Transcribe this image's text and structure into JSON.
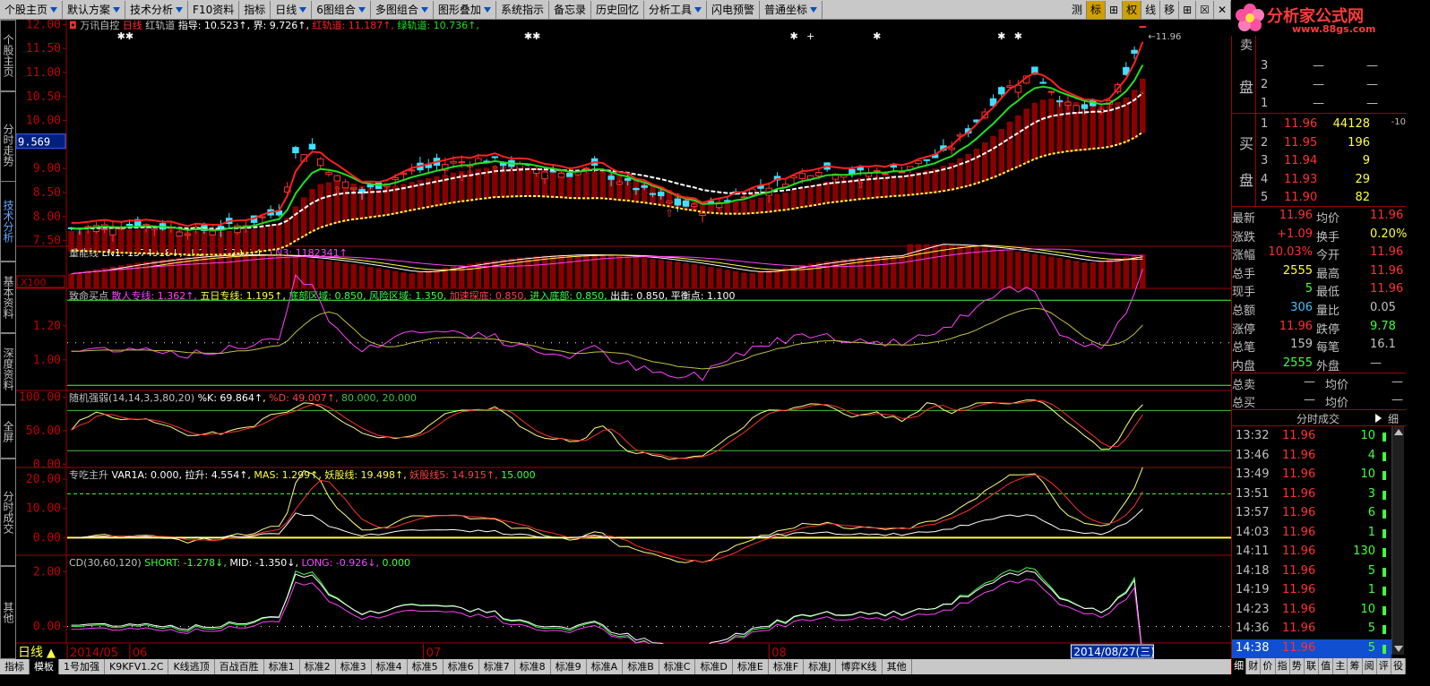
{
  "toolbar": {
    "items": [
      {
        "label": "个股主页",
        "arrow": true
      },
      {
        "label": "默认方案",
        "arrow": true
      },
      {
        "label": "技术分析",
        "arrow": true
      },
      {
        "label": "F10资料",
        "arrow": false
      },
      {
        "label": "指标",
        "arrow": false
      },
      {
        "label": "日线",
        "arrow": true
      },
      {
        "label": "6图组合",
        "arrow": true
      },
      {
        "label": "多图组合",
        "arrow": true
      },
      {
        "label": "图形叠加",
        "arrow": true
      },
      {
        "label": "系统指示",
        "arrow": false
      },
      {
        "label": "备忘录",
        "arrow": false
      },
      {
        "label": "历史回忆",
        "arrow": false
      },
      {
        "label": "分析工具",
        "arrow": true
      },
      {
        "label": "闪电预警",
        "arrow": false
      },
      {
        "label": "普通坐标",
        "arrow": true
      }
    ],
    "right_buttons": [
      "测",
      "标",
      "⊞",
      "权",
      "线",
      "移",
      "⊞",
      "☒",
      "✕"
    ]
  },
  "logo": {
    "title": "分析家公式网",
    "url": "www.88gs.com"
  },
  "left_nav": [
    "个股主页",
    "分时走势",
    "技术分析",
    "基本资料",
    "深度资料",
    "全屏",
    "分时成交",
    "其他"
  ],
  "left_nav_active": 2,
  "main_chart": {
    "header": {
      "name": "万讯自控",
      "period": "日线",
      "indicator": "红轨道",
      "items": [
        {
          "text": "指导: 10.523↑,",
          "color": "#ffffff"
        },
        {
          "text": "界: 9.726↑,",
          "color": "#ffffff"
        },
        {
          "text": "红轨道: 11.187↑,",
          "color": "#ff2020"
        },
        {
          "text": "绿轨道: 10.736↑,",
          "color": "#20e020"
        }
      ]
    },
    "y_ticks": [
      "12.00",
      "11.50",
      "11.00",
      "10.50",
      "10.00",
      "9.50",
      "9.00",
      "8.50",
      "8.00",
      "7.50"
    ],
    "y_range": [
      7.4,
      12.1
    ],
    "cursor_price": "9.569",
    "max_label": "11.96"
  },
  "volume": {
    "header": "量能线",
    "items": [
      {
        "text": "LN1: 1374918↓,",
        "color": "#ffffff"
      },
      {
        "text": "LN2: 1372911↑,",
        "color": "#ffff40"
      },
      {
        "text": "LN3: 1182341↑",
        "color": "#ff40ff"
      }
    ],
    "scale_label": "X100"
  },
  "p1": {
    "header": "致命买点",
    "items": [
      {
        "text": "散人专线: 1.362↑,",
        "color": "#ff40ff"
      },
      {
        "text": "五日专线: 1.195↑,",
        "color": "#ffff40"
      },
      {
        "text": "底部区域: 0.850,",
        "color": "#40ff40"
      },
      {
        "text": "风险区域: 1.350,",
        "color": "#40ff40"
      },
      {
        "text": "加速探底: 0.850,",
        "color": "#ff4040"
      },
      {
        "text": "进入底部: 0.850,",
        "color": "#40ff40"
      },
      {
        "text": "出击: 0.850,",
        "color": "#ffffff"
      },
      {
        "text": "平衡点: 1.100",
        "color": "#ffffff"
      }
    ],
    "y_ticks": [
      "1.20",
      "1.00"
    ]
  },
  "p2": {
    "header": "随机强弱(14,14,3,3,80,20)",
    "items": [
      {
        "text": "%K: 69.864↑,",
        "color": "#ffffff"
      },
      {
        "text": "%D: 49.007↑,",
        "color": "#ff4040"
      },
      {
        "text": "80.000,",
        "color": "#40c040"
      },
      {
        "text": "20.000",
        "color": "#40c040"
      }
    ],
    "y_ticks": [
      "100.00",
      "50.00",
      "0.00"
    ]
  },
  "p3": {
    "header": "专吃主升",
    "items": [
      {
        "text": "VAR1A: 0.000,",
        "color": "#ffffff"
      },
      {
        "text": "拉升: 4.554↑,",
        "color": "#ffffff"
      },
      {
        "text": "MAS: 1.299↑,",
        "color": "#ffff40"
      },
      {
        "text": "妖股线: 19.498↑,",
        "color": "#ffff40"
      },
      {
        "text": "妖股线5: 14.915↑,",
        "color": "#ff4040"
      },
      {
        "text": "15.000",
        "color": "#40ff40"
      }
    ],
    "y_ticks": [
      "20.00",
      "10.00",
      "0.00"
    ]
  },
  "p4": {
    "header": "CD(30,60,120)",
    "items": [
      {
        "text": "SHORT: -1.278↓,",
        "color": "#40ff40"
      },
      {
        "text": "MID: -1.350↓,",
        "color": "#ffffff"
      },
      {
        "text": "LONG: -0.926↓,",
        "color": "#ff40ff"
      },
      {
        "text": "0.000",
        "color": "#40ff40"
      }
    ],
    "y_ticks": [
      "2.00",
      "0.00"
    ]
  },
  "time_axis": {
    "period_label": "日线",
    "labels": [
      {
        "text": "2014/05",
        "at": 0.0
      },
      {
        "text": "06",
        "at": 0.058
      },
      {
        "text": "07",
        "at": 0.33
      },
      {
        "text": "08",
        "at": 0.65
      }
    ],
    "cursor_date": "2014/08/27(三)"
  },
  "bottom_tabs": {
    "tabs": [
      "指标",
      "模板",
      "1号加强",
      "K9KFV1.2C",
      "K线逃顶",
      "百战百胜",
      "标准1",
      "标准2",
      "标准3",
      "标准4",
      "标准5",
      "标准6",
      "标准7",
      "标准8",
      "标准9",
      "标准A",
      "标准B",
      "标准C",
      "标准D",
      "标准E",
      "标准F",
      "标准J",
      "博弈K线",
      "其他"
    ],
    "active": 1
  },
  "order_book": {
    "sell": [
      {
        "level": "3",
        "price": "—",
        "volume": "—"
      },
      {
        "level": "2",
        "price": "—",
        "volume": "—"
      },
      {
        "level": "1",
        "price": "—",
        "volume": "—"
      }
    ],
    "sell_label": "卖盘",
    "buy_label": "买盘",
    "buy": [
      {
        "level": "1",
        "price": "11.96",
        "volume": "44128",
        "extra": "-10"
      },
      {
        "level": "2",
        "price": "11.95",
        "volume": "196",
        "extra": ""
      },
      {
        "level": "3",
        "price": "11.94",
        "volume": "9",
        "extra": ""
      },
      {
        "level": "4",
        "price": "11.93",
        "volume": "29",
        "extra": ""
      },
      {
        "level": "5",
        "price": "11.90",
        "volume": "82",
        "extra": ""
      }
    ]
  },
  "quote": {
    "rows": [
      {
        "l1": "最新",
        "v1": "11.96",
        "c1": "#ff3030",
        "l2": "均价",
        "v2": "11.96",
        "c2": "#ff3030"
      },
      {
        "l1": "涨跌",
        "v1": "+1.09",
        "c1": "#ff3030",
        "l2": "换手",
        "v2": "0.20%",
        "c2": "#ffff40"
      },
      {
        "l1": "涨幅",
        "v1": "10.03%",
        "c1": "#ff3030",
        "l2": "今开",
        "v2": "11.96",
        "c2": "#ff3030"
      },
      {
        "l1": "总手",
        "v1": "2555",
        "c1": "#ffff40",
        "l2": "最高",
        "v2": "11.96",
        "c2": "#ff3030"
      },
      {
        "l1": "现手",
        "v1": "5",
        "c1": "#40ff40",
        "l2": "最低",
        "v2": "11.96",
        "c2": "#ff3030"
      },
      {
        "l1": "总额",
        "v1": "306",
        "c1": "#40c0ff",
        "l2": "量比",
        "v2": "0.05",
        "c2": "#c0c0c0"
      },
      {
        "l1": "涨停",
        "v1": "11.96",
        "c1": "#ff3030",
        "l2": "跌停",
        "v2": "9.78",
        "c2": "#40ff40"
      },
      {
        "l1": "总笔",
        "v1": "159",
        "c1": "#c0c0c0",
        "l2": "每笔",
        "v2": "16.1",
        "c2": "#c0c0c0"
      },
      {
        "l1": "内盘",
        "v1": "2555",
        "c1": "#40ff40",
        "l2": "外盘",
        "v2": "—",
        "c2": "#c0c0c0"
      }
    ],
    "extra": [
      {
        "l1": "总卖",
        "v1": "—",
        "l2": "均价",
        "v2": "—"
      },
      {
        "l1": "总买",
        "v1": "—",
        "l2": "均价",
        "v2": "—"
      }
    ]
  },
  "ticks": {
    "header": "分时成交",
    "group": "细",
    "rows": [
      {
        "time": "13:32",
        "price": "11.96",
        "vol": "10"
      },
      {
        "time": "13:46",
        "price": "11.96",
        "vol": "4"
      },
      {
        "time": "13:49",
        "price": "11.96",
        "vol": "10"
      },
      {
        "time": "13:51",
        "price": "11.96",
        "vol": "3"
      },
      {
        "time": "13:57",
        "price": "11.96",
        "vol": "6"
      },
      {
        "time": "14:03",
        "price": "11.96",
        "vol": "1"
      },
      {
        "time": "14:11",
        "price": "11.96",
        "vol": "130"
      },
      {
        "time": "14:18",
        "price": "11.96",
        "vol": "5"
      },
      {
        "time": "14:19",
        "price": "11.96",
        "vol": "1"
      },
      {
        "time": "14:23",
        "price": "11.96",
        "vol": "10"
      },
      {
        "time": "14:36",
        "price": "11.96",
        "vol": "5"
      },
      {
        "time": "14:38",
        "price": "11.96",
        "vol": "5"
      }
    ],
    "selected": 11
  },
  "right_tabs": [
    "细",
    "财",
    "价",
    "指",
    "势",
    "联",
    "值",
    "主",
    "筹",
    "阅",
    "评",
    "役"
  ],
  "right_tabs_active": 0
}
